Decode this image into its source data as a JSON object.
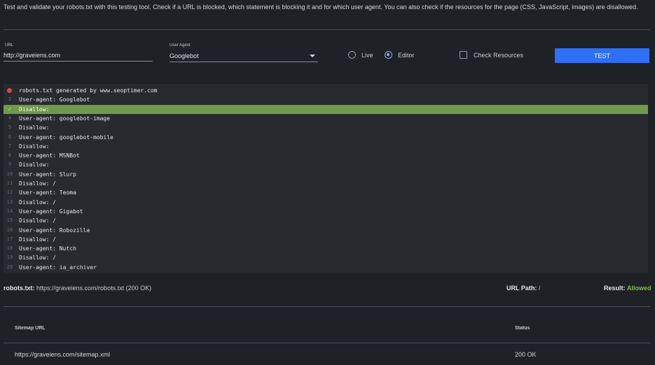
{
  "intro": "Test and validate your robots.txt with this testing tool. Check if a URL is blocked, which statement is blocking it and for which user agent. You can also check if the resources for the page (CSS, JavaScript, images) are disallowed.",
  "form": {
    "url_label": "URL",
    "url_value": "http://graveiens.com",
    "ua_label": "User Agent",
    "ua_value": "Googlebot",
    "mode_live": "Live",
    "mode_editor": "Editor",
    "mode_selected": "Editor",
    "check_resources": "Check Resources",
    "check_resources_checked": false,
    "test_button": "TEST"
  },
  "editor": {
    "lines": [
      {
        "num": "",
        "text": "robots.txt generated by www.seoptimer.com",
        "marker": "error"
      },
      {
        "num": "2",
        "text": "User-agent: Googlebot"
      },
      {
        "num": "✓",
        "text": "Disallow:",
        "highlight": true
      },
      {
        "num": "4",
        "text": "User-agent: googlebot-image"
      },
      {
        "num": "5",
        "text": "Disallow:"
      },
      {
        "num": "6",
        "text": "User-agent: googlebot-mobile"
      },
      {
        "num": "7",
        "text": "Disallow:"
      },
      {
        "num": "8",
        "text": "User-agent: MSNBot"
      },
      {
        "num": "9",
        "text": "Disallow:"
      },
      {
        "num": "10",
        "text": "User-agent: Slurp"
      },
      {
        "num": "11",
        "text": "Disallow: /"
      },
      {
        "num": "12",
        "text": "User-agent: Teoma"
      },
      {
        "num": "13",
        "text": "Disallow: /"
      },
      {
        "num": "14",
        "text": "User-agent: Gigabot"
      },
      {
        "num": "15",
        "text": "Disallow: /"
      },
      {
        "num": "16",
        "text": "User-agent: Robozilla"
      },
      {
        "num": "17",
        "text": "Disallow: /"
      },
      {
        "num": "18",
        "text": "User-agent: Nutch"
      },
      {
        "num": "19",
        "text": "Disallow: /"
      },
      {
        "num": "20",
        "text": "User-agent: ia_archiver"
      }
    ]
  },
  "result": {
    "robots_label": "robots.txt:",
    "robots_value": "https://graveiens.com/robots.txt (200 OK)",
    "path_label": "URL Path:",
    "path_value": "/",
    "result_label": "Result:",
    "result_value": "Allowed"
  },
  "sitemap": {
    "col_url": "Sitemap URL",
    "col_status": "Status",
    "rows": [
      {
        "url": "https://graveiens.com/sitemap.xml",
        "status": "200 OK"
      }
    ]
  },
  "colors": {
    "accent": "#2f6ff5",
    "highlight": "#6e9a4a",
    "allowed": "#7cc44d",
    "error": "#d14a3c"
  }
}
